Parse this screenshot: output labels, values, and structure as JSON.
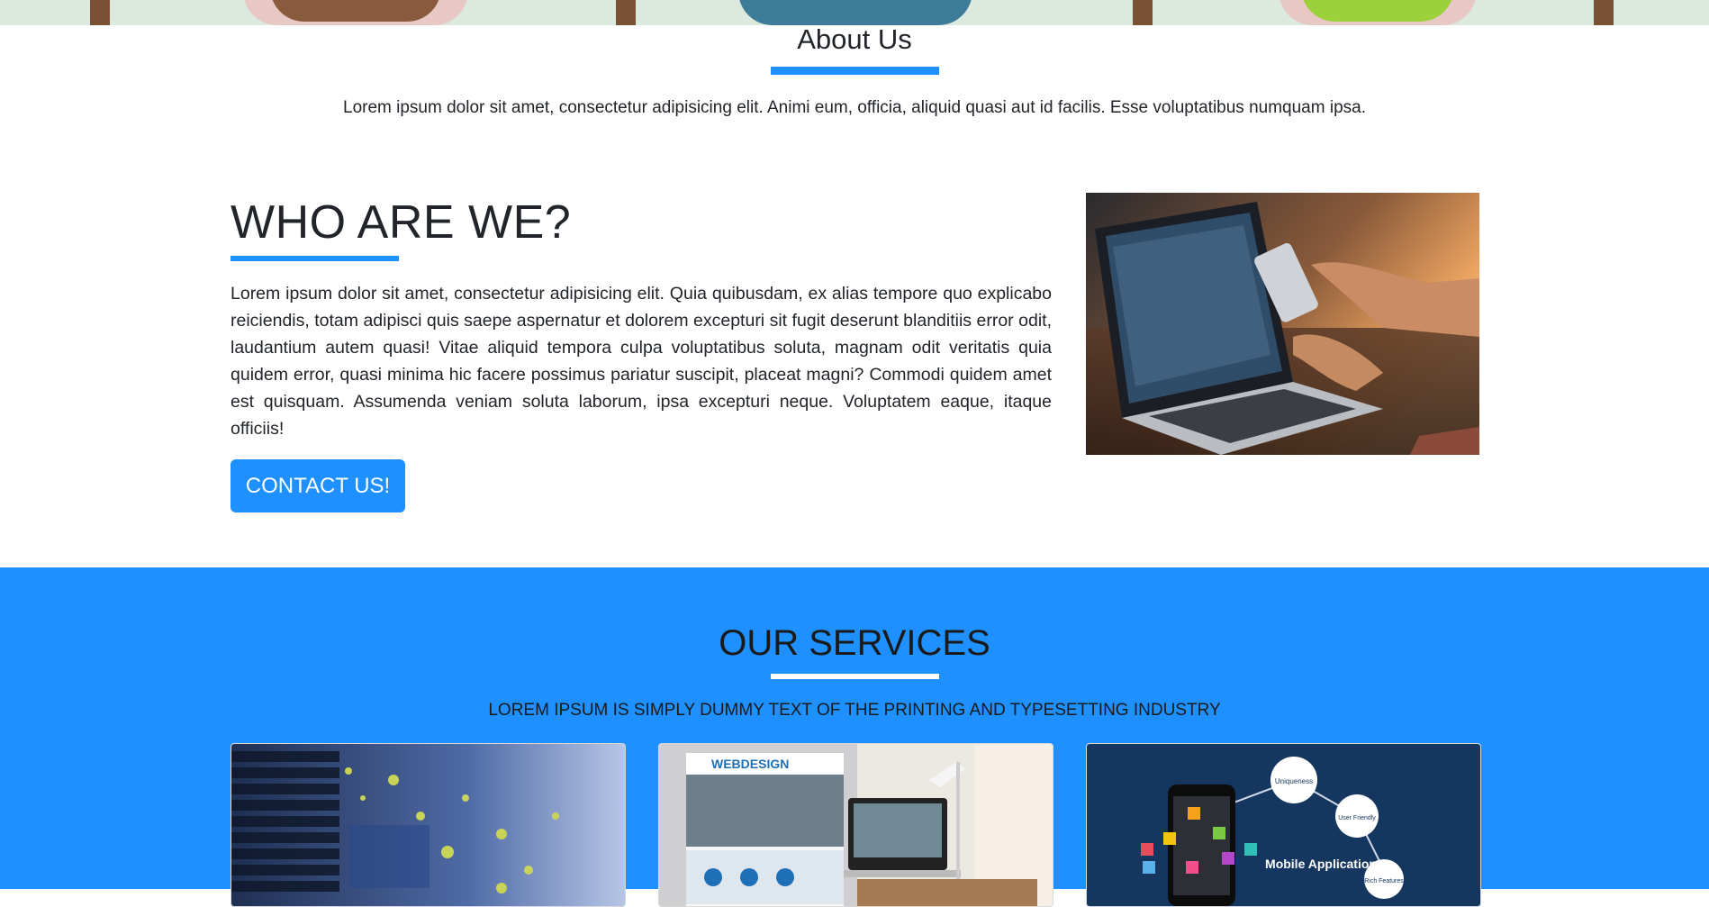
{
  "hero": {},
  "about": {
    "title": "About Us",
    "text": "Lorem ipsum dolor sit amet, consectetur adipisicing elit. Animi eum, officia, aliquid quasi aut id facilis. Esse voluptatibus numquam ipsa."
  },
  "who": {
    "title": "WHO ARE WE?",
    "text": "Lorem ipsum dolor sit amet, consectetur adipisicing elit. Quia quibusdam, ex alias tempore quo explicabo reiciendis, totam adipisci quis saepe aspernatur et dolorem excepturi sit fugit deserunt blanditiis error odit, laudantium autem quasi! Vitae aliquid tempora culpa voluptatibus soluta, magnam odit veritatis quia quidem error, quasi minima hic facere possimus pariatur suscipit, placeat magni? Commodi quidem amet est quisquam. Assumenda veniam soluta laborum, ipsa excepturi neque. Voluptatem eaque, itaque officiis!",
    "button": "CONTACT US!"
  },
  "services": {
    "title": "OUR SERVICES",
    "subtitle": "LOREM IPSUM IS SIMPLY DUMMY TEXT OF THE PRINTING AND TYPESETTING INDUSTRY",
    "cards": [
      {
        "image_caption": ""
      },
      {
        "image_caption": "WEBDESIGN"
      },
      {
        "image_caption": "Mobile Application",
        "badges": [
          "Uniqueness",
          "User Friendly",
          "Rich Features"
        ]
      }
    ]
  },
  "colors": {
    "accent": "#1e90ff",
    "text": "#212529",
    "white": "#ffffff"
  }
}
